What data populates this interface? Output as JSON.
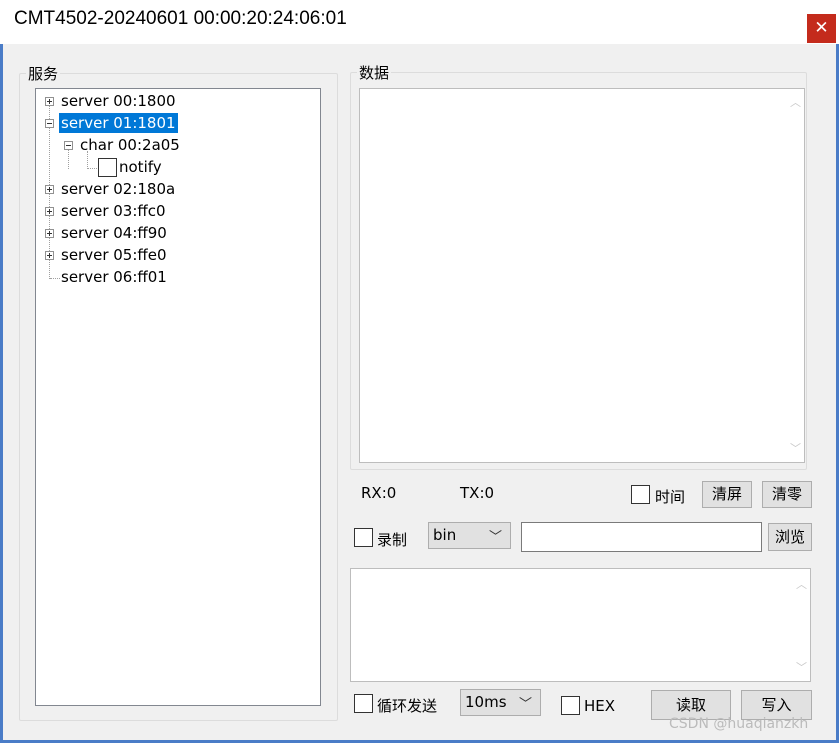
{
  "window": {
    "title": "CMT4502-20240601 00:00:20:24:06:01",
    "close_glyph": "✕"
  },
  "services": {
    "legend": "服务",
    "tree": [
      {
        "label": "server 00:1800",
        "expander": "plus"
      },
      {
        "label": "server 01:1801",
        "expander": "minus",
        "selected": true
      },
      {
        "label": "char 00:2a05",
        "expander": "minus"
      },
      {
        "label": "notify",
        "checkbox": true
      },
      {
        "label": "server 02:180a",
        "expander": "plus"
      },
      {
        "label": "server 03:ffc0",
        "expander": "plus"
      },
      {
        "label": "server 04:ff90",
        "expander": "plus"
      },
      {
        "label": "server 05:ffe0",
        "expander": "plus"
      },
      {
        "label": "server 06:ff01",
        "expander": "none"
      }
    ]
  },
  "data": {
    "legend": "数据",
    "rx": "RX:0",
    "tx": "TX:0",
    "time_label": "时间",
    "clear_screen": "清屏",
    "clear_zero": "清零",
    "record_label": "录制",
    "format_select": "bin",
    "file_path": "",
    "browse": "浏览",
    "loop_send_label": "循环发送",
    "interval_select": "10ms",
    "hex_label": "HEX",
    "read": "读取",
    "write": "写入"
  },
  "icons": {
    "scroll_up": "chevron-up-icon",
    "scroll_down": "chevron-down-icon",
    "dropdown": "chevron-down-icon"
  },
  "colors": {
    "selection": "#0078d7",
    "close_button": "#c42b1c",
    "window_border": "#4a7cc7"
  },
  "watermark": "CSDN @huaqianzkh"
}
